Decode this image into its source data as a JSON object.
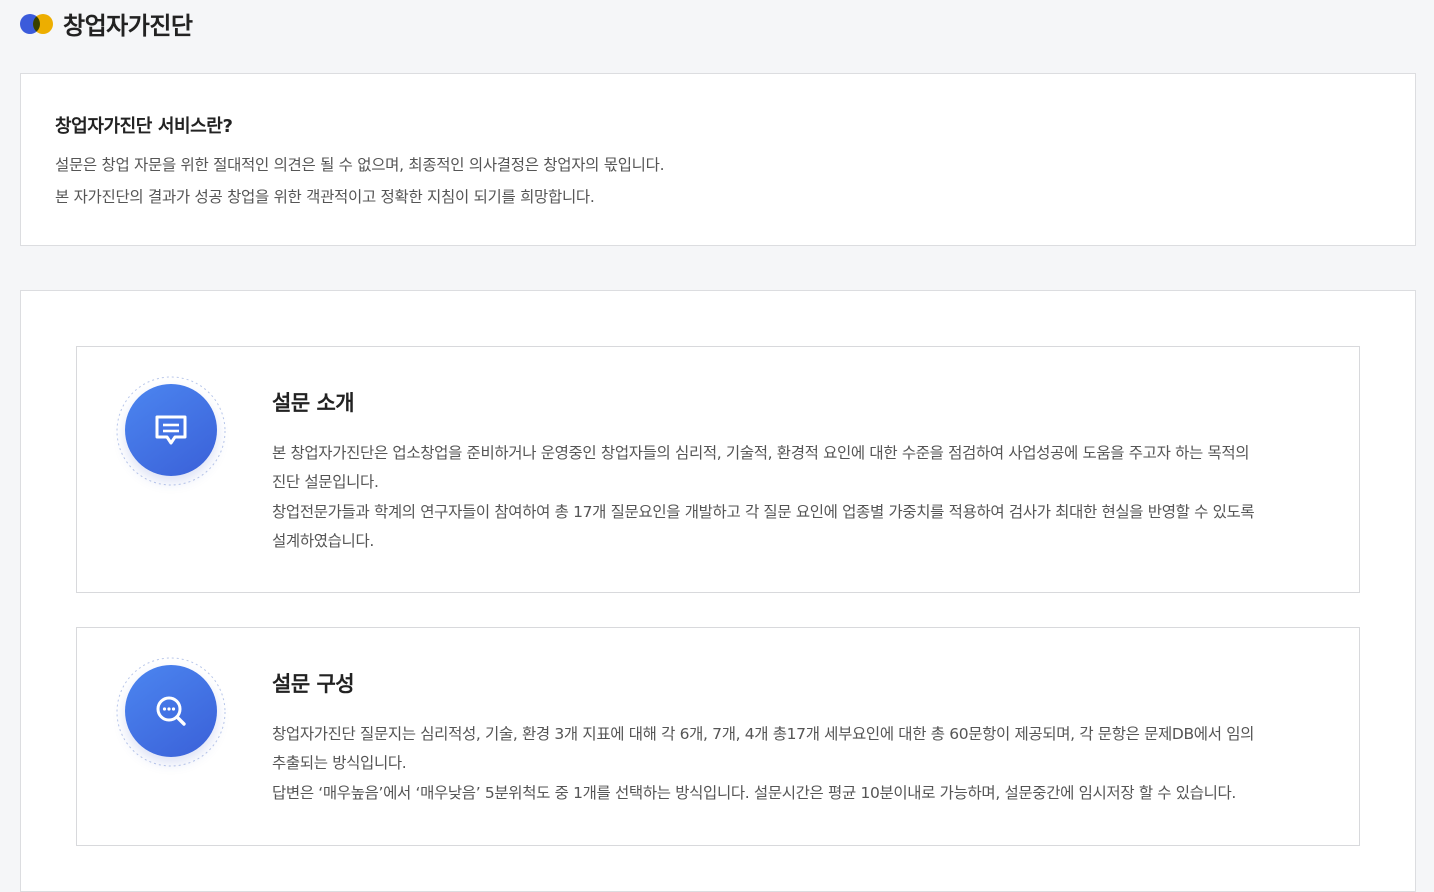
{
  "header": {
    "title": "창업자가진단"
  },
  "intro": {
    "title": "창업자가진단 서비스란?",
    "lines": [
      "설문은 창업 자문을 위한 절대적인 의견은 될 수 없으며, 최종적인 의사결정은 창업자의 몫입니다.",
      "본 자가진단의 결과가 성공 창업을 위한 객관적이고 정확한 지침이 되기를 희망합니다."
    ]
  },
  "sections": [
    {
      "icon": "chat-icon",
      "title": "설문 소개",
      "lines": [
        "본 창업자가진단은 업소창업을 준비하거나 운영중인 창업자들의 심리적, 기술적, 환경적 요인에 대한 수준을 점검하여 사업성공에 도움을 주고자 하는 목적의",
        "진단 설문입니다.",
        "창업전문가들과 학계의 연구자들이 참여하여 총 17개 질문요인을 개발하고 각 질문 요인에 업종별 가중치를 적용하여 검사가 최대한 현실을 반영할 수 있도록",
        "설계하였습니다."
      ]
    },
    {
      "icon": "search-icon",
      "title": "설문 구성",
      "lines": [
        "창업자가진단 질문지는 심리적성, 기술, 환경 3개 지표에 대해 각 6개, 7개, 4개 총17개 세부요인에 대한 총 60문항이 제공되며, 각 문항은 문제DB에서 임의",
        "추출되는 방식입니다.",
        "답변은 ‘매우높음’에서 ‘매우낮음’ 5분위척도 중 1개를 선택하는 방식입니다. 설문시간은 평균 10분이내로 가능하며, 설문중간에 임시저장 할 수 있습니다."
      ]
    }
  ],
  "colors": {
    "accent_blue": "#3b5bdb",
    "accent_yellow": "#f7b500",
    "icon_gradient_start": "#4c86f0",
    "icon_gradient_end": "#3a60d8"
  }
}
